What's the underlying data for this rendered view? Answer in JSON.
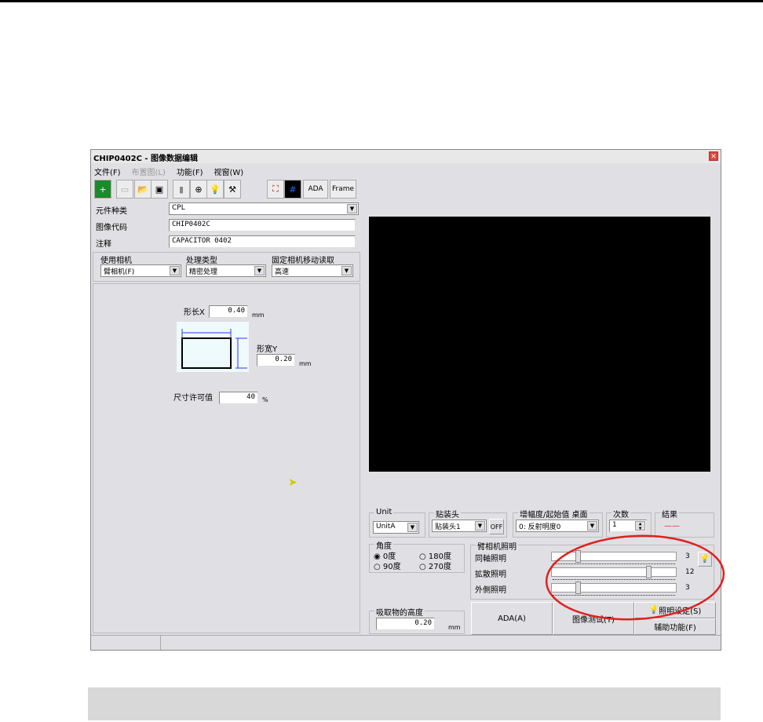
{
  "window": {
    "title": "CHIP0402C - 图像数据编辑",
    "close": "✕"
  },
  "menu": [
    "文件(F)",
    "布置图(L)",
    "功能(F)",
    "视窗(W)"
  ],
  "toolbar": {
    "ada": "ADA",
    "frame": "Frame"
  },
  "fields": {
    "component_type_label": "元件种类",
    "component_type": "CPL",
    "image_code_label": "图像代码",
    "image_code": "CHIP0402C",
    "comment_label": "注释",
    "comment": "CAPACITOR 0402"
  },
  "options": {
    "camera_label": "使用相机",
    "camera": "臂相机(F)",
    "process_label": "处理类型",
    "process": "精密处理",
    "fixed_cam_label": "固定相机移动读取",
    "fixed_cam": "高速"
  },
  "dimensions": {
    "length_label": "形长X",
    "length": "0.40",
    "length_unit": "mm",
    "width_label": "形宽Y",
    "width": "0.20",
    "width_unit": "mm",
    "tolerance_label": "尺寸许可值",
    "tolerance": "40",
    "tolerance_unit": "%"
  },
  "controls": {
    "unit_label": "Unit",
    "unit": "UnitA",
    "head_label": "贴装头",
    "head": "贴装头1",
    "off": "OFF",
    "gain_label": "增幅度/起始值 桌面",
    "gain": "0: 反射明度0",
    "count_label": "次数",
    "count": "1",
    "result_label": "结果",
    "result": "——",
    "angle_label": "角度",
    "angles": [
      "0度",
      "90度",
      "180度",
      "270度"
    ],
    "angle_selected": "0度",
    "lighting_label": "臂相机照明",
    "lights": [
      {
        "label": "同軸照明",
        "value": 3
      },
      {
        "label": "拡散照明",
        "value": 12
      },
      {
        "label": "外側照明",
        "value": 3
      }
    ],
    "light_max": 15,
    "height_label": "吸取物的高度",
    "height": "0.20",
    "height_unit": "mm",
    "btn_ada": "ADA(A)",
    "btn_test": "图像测试(T)",
    "btn_light": "照明设定(S)",
    "btn_aux": "辅助功能(F)"
  },
  "colors": {
    "annotation": "#e02020",
    "screen": "#000000"
  }
}
